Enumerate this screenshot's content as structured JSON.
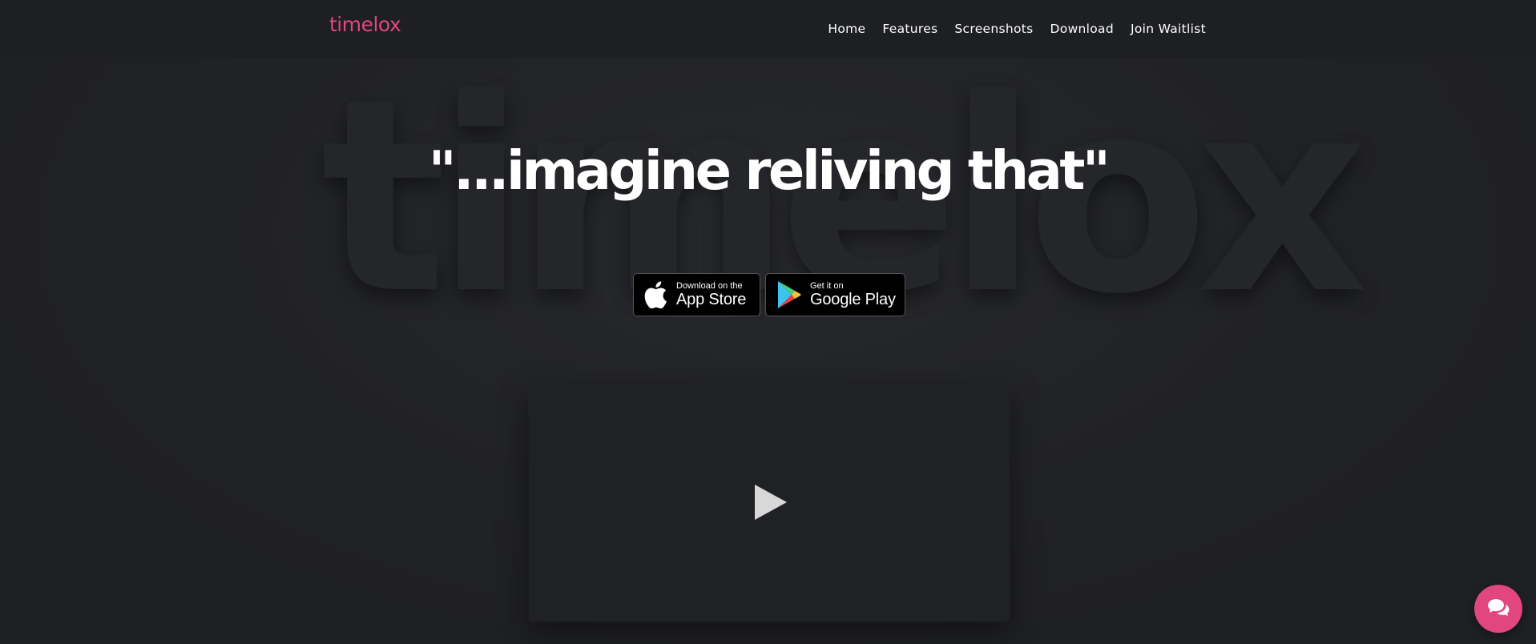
{
  "brand": {
    "logo_text": "timelox",
    "accent_color": "#e2467f"
  },
  "nav": {
    "items": [
      {
        "label": "Home"
      },
      {
        "label": "Features"
      },
      {
        "label": "Screenshots"
      },
      {
        "label": "Download"
      },
      {
        "label": "Join Waitlist"
      }
    ]
  },
  "hero": {
    "background_word": "timelox",
    "headline": "\"...imagine reliving that\"",
    "app_store": {
      "small": "Download on the",
      "big": "App Store",
      "icon": "apple-icon"
    },
    "google_play": {
      "small": "Get it on",
      "big": "Google Play",
      "icon": "google-play-icon"
    }
  },
  "video": {
    "icon": "play-icon"
  },
  "chat": {
    "icon": "chat-icon"
  }
}
